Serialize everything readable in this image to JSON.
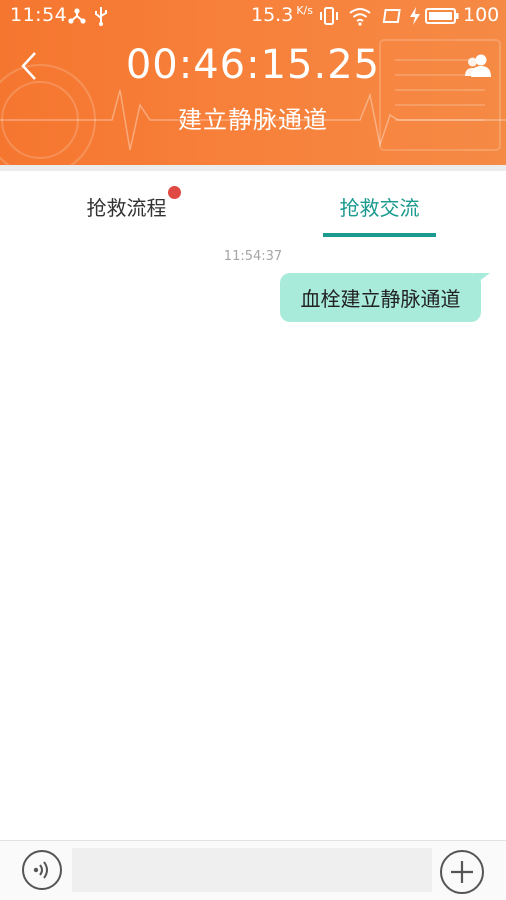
{
  "status_bar": {
    "time": "11:54",
    "net_speed": "15.3",
    "net_speed_unit": "K/s",
    "battery_level": "100",
    "icons": [
      "share-icon",
      "usb-icon",
      "vibrate-icon",
      "wifi-icon",
      "cast-icon",
      "charging-icon",
      "battery-icon"
    ]
  },
  "header": {
    "timer": "00:46:15.25",
    "stage_title": "建立静脉通道",
    "back_icon": "chevron-left-icon",
    "contacts_icon": "contacts-icon",
    "accent_color": "#f5762f"
  },
  "tabs": [
    {
      "label": "抢救流程",
      "active": false,
      "has_badge": true
    },
    {
      "label": "抢救交流",
      "active": true,
      "has_badge": false
    }
  ],
  "tab_active_color": "#1b9a8f",
  "chat": {
    "messages": [
      {
        "time": "11:54:37",
        "text": "血栓建立静脉通道",
        "outgoing": true,
        "bubble_color": "#a8ebdb"
      }
    ]
  },
  "input_bar": {
    "voice_icon": "voice-icon",
    "plus_icon": "plus-icon",
    "input_value": "",
    "input_placeholder": ""
  }
}
